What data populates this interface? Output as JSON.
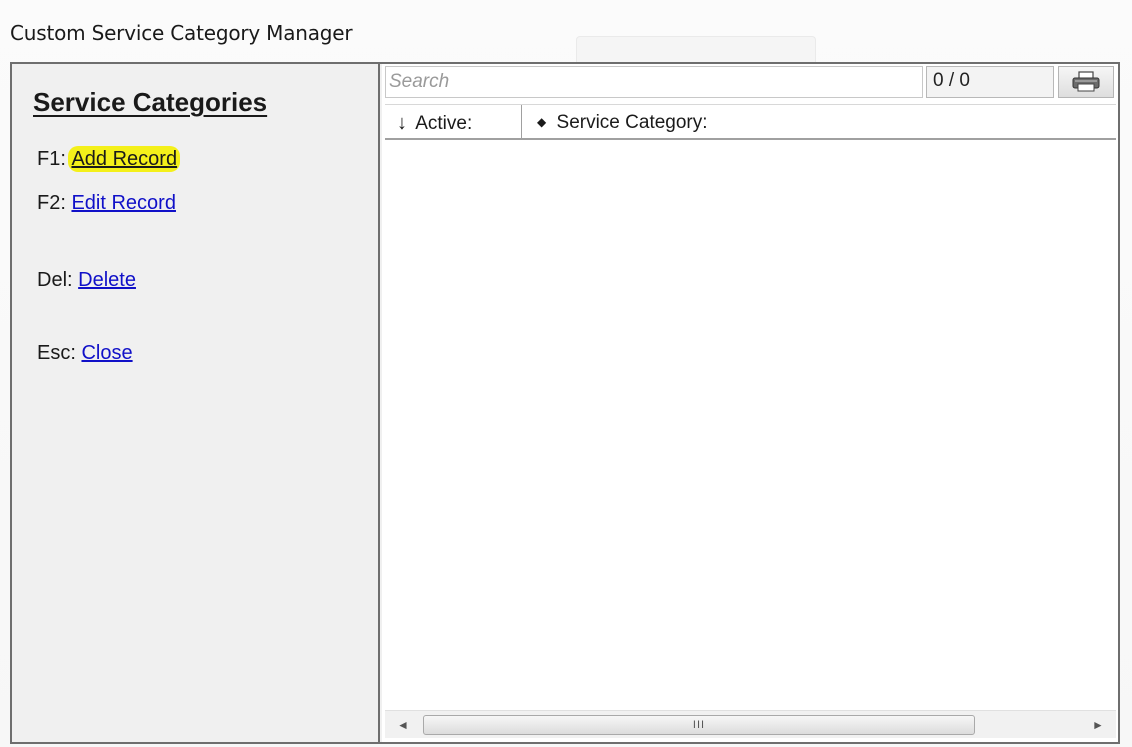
{
  "window": {
    "title": "Custom Service Category Manager"
  },
  "left_panel": {
    "heading": "Service Categories",
    "commands": [
      {
        "key": "F1:",
        "label": "Add Record",
        "highlighted": true
      },
      {
        "key": "F2:",
        "label": "Edit Record",
        "highlighted": false
      },
      {
        "key": "Del:",
        "label": "Delete",
        "highlighted": false
      },
      {
        "key": "Esc:",
        "label": "Close",
        "highlighted": false
      }
    ]
  },
  "toolbar": {
    "search_placeholder": "Search",
    "counter": "0 / 0",
    "print_icon": "printer-icon"
  },
  "grid": {
    "columns": [
      {
        "sort_glyph": "↓",
        "label": "Active:"
      },
      {
        "sort_glyph": "◆",
        "label": "Service Category:"
      }
    ],
    "rows": []
  },
  "scrollbar": {
    "thumb_grip": "III",
    "left_arrow": "◄",
    "right_arrow": "►"
  },
  "colors": {
    "link": "#1010c8",
    "highlight": "#f4f01a",
    "border": "#6e6e6e"
  }
}
